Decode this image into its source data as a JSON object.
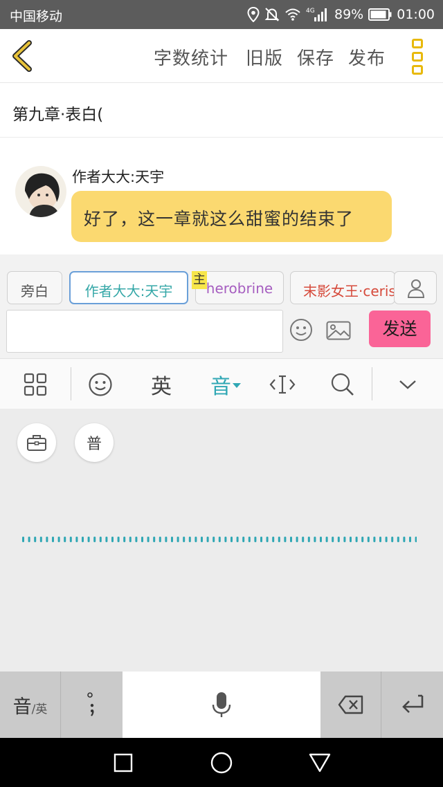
{
  "status_bar": {
    "carrier": "中国移动",
    "network": "4G",
    "battery": "89%",
    "time": "01:00"
  },
  "header": {
    "back_icon": "chevron-left-icon",
    "word_count": "字数统计",
    "old_version": "旧版",
    "save": "保存",
    "publish": "发布",
    "more_icon": "more-vertical-icon",
    "accent": "#e8b90c"
  },
  "chapter": {
    "title": "第九章·表白("
  },
  "chat": {
    "speaker": "作者大大:天宇",
    "message": "好了，这一章就这么甜蜜的结束了",
    "bubble_color": "#fbd970"
  },
  "roles": {
    "items": [
      {
        "label": "旁白"
      },
      {
        "label": "作者大大:天宇"
      },
      {
        "label": "herobrine"
      },
      {
        "label": "末影女王·ceris"
      }
    ],
    "main_badge": "主",
    "add_icon": "person-icon"
  },
  "composer": {
    "placeholder": "",
    "send": "发送",
    "send_color": "#fa6497"
  },
  "ime_toolbar": {
    "english": "英",
    "voice": "音",
    "accent": "#2fa7b4"
  },
  "voice_panel": {
    "mandarin": "普"
  },
  "keyboard": {
    "lang_main": "音",
    "lang_alt": "/英",
    "punct": "，。"
  }
}
